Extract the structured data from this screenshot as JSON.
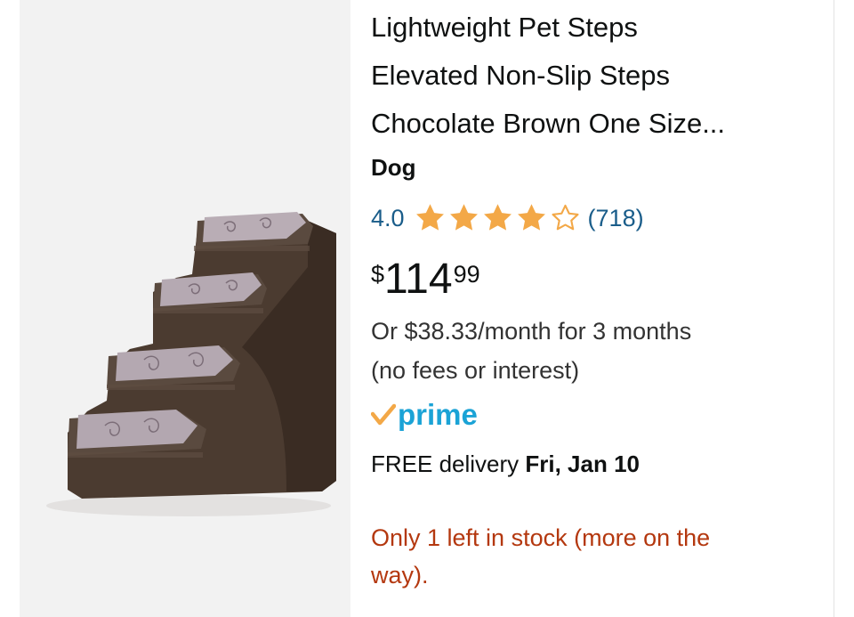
{
  "product": {
    "title_lines": [
      "Lightweight Pet Steps",
      "Elevated Non-Slip Steps",
      "Chocolate Brown One Size..."
    ],
    "brand": "Dog",
    "image_icon": "pet-steps-image",
    "rating": {
      "value": "4.0",
      "stars": 4,
      "max_stars": 5,
      "count": "(718)",
      "star_color": "#f3a847"
    },
    "price": {
      "symbol": "$",
      "whole": "114",
      "fraction": "99"
    },
    "installment_lines": [
      "Or $38.33/month for 3 months",
      "(no fees or interest)"
    ],
    "prime": {
      "check": "✓",
      "label": "prime",
      "check_color": "#f3a847",
      "color": "#1ba3d6"
    },
    "delivery": {
      "prefix": "FREE delivery ",
      "date": "Fri, Jan 10"
    },
    "stock_lines": [
      "Only 1 left in stock (more on the",
      "way)."
    ],
    "stock_color": "#b4380f"
  }
}
